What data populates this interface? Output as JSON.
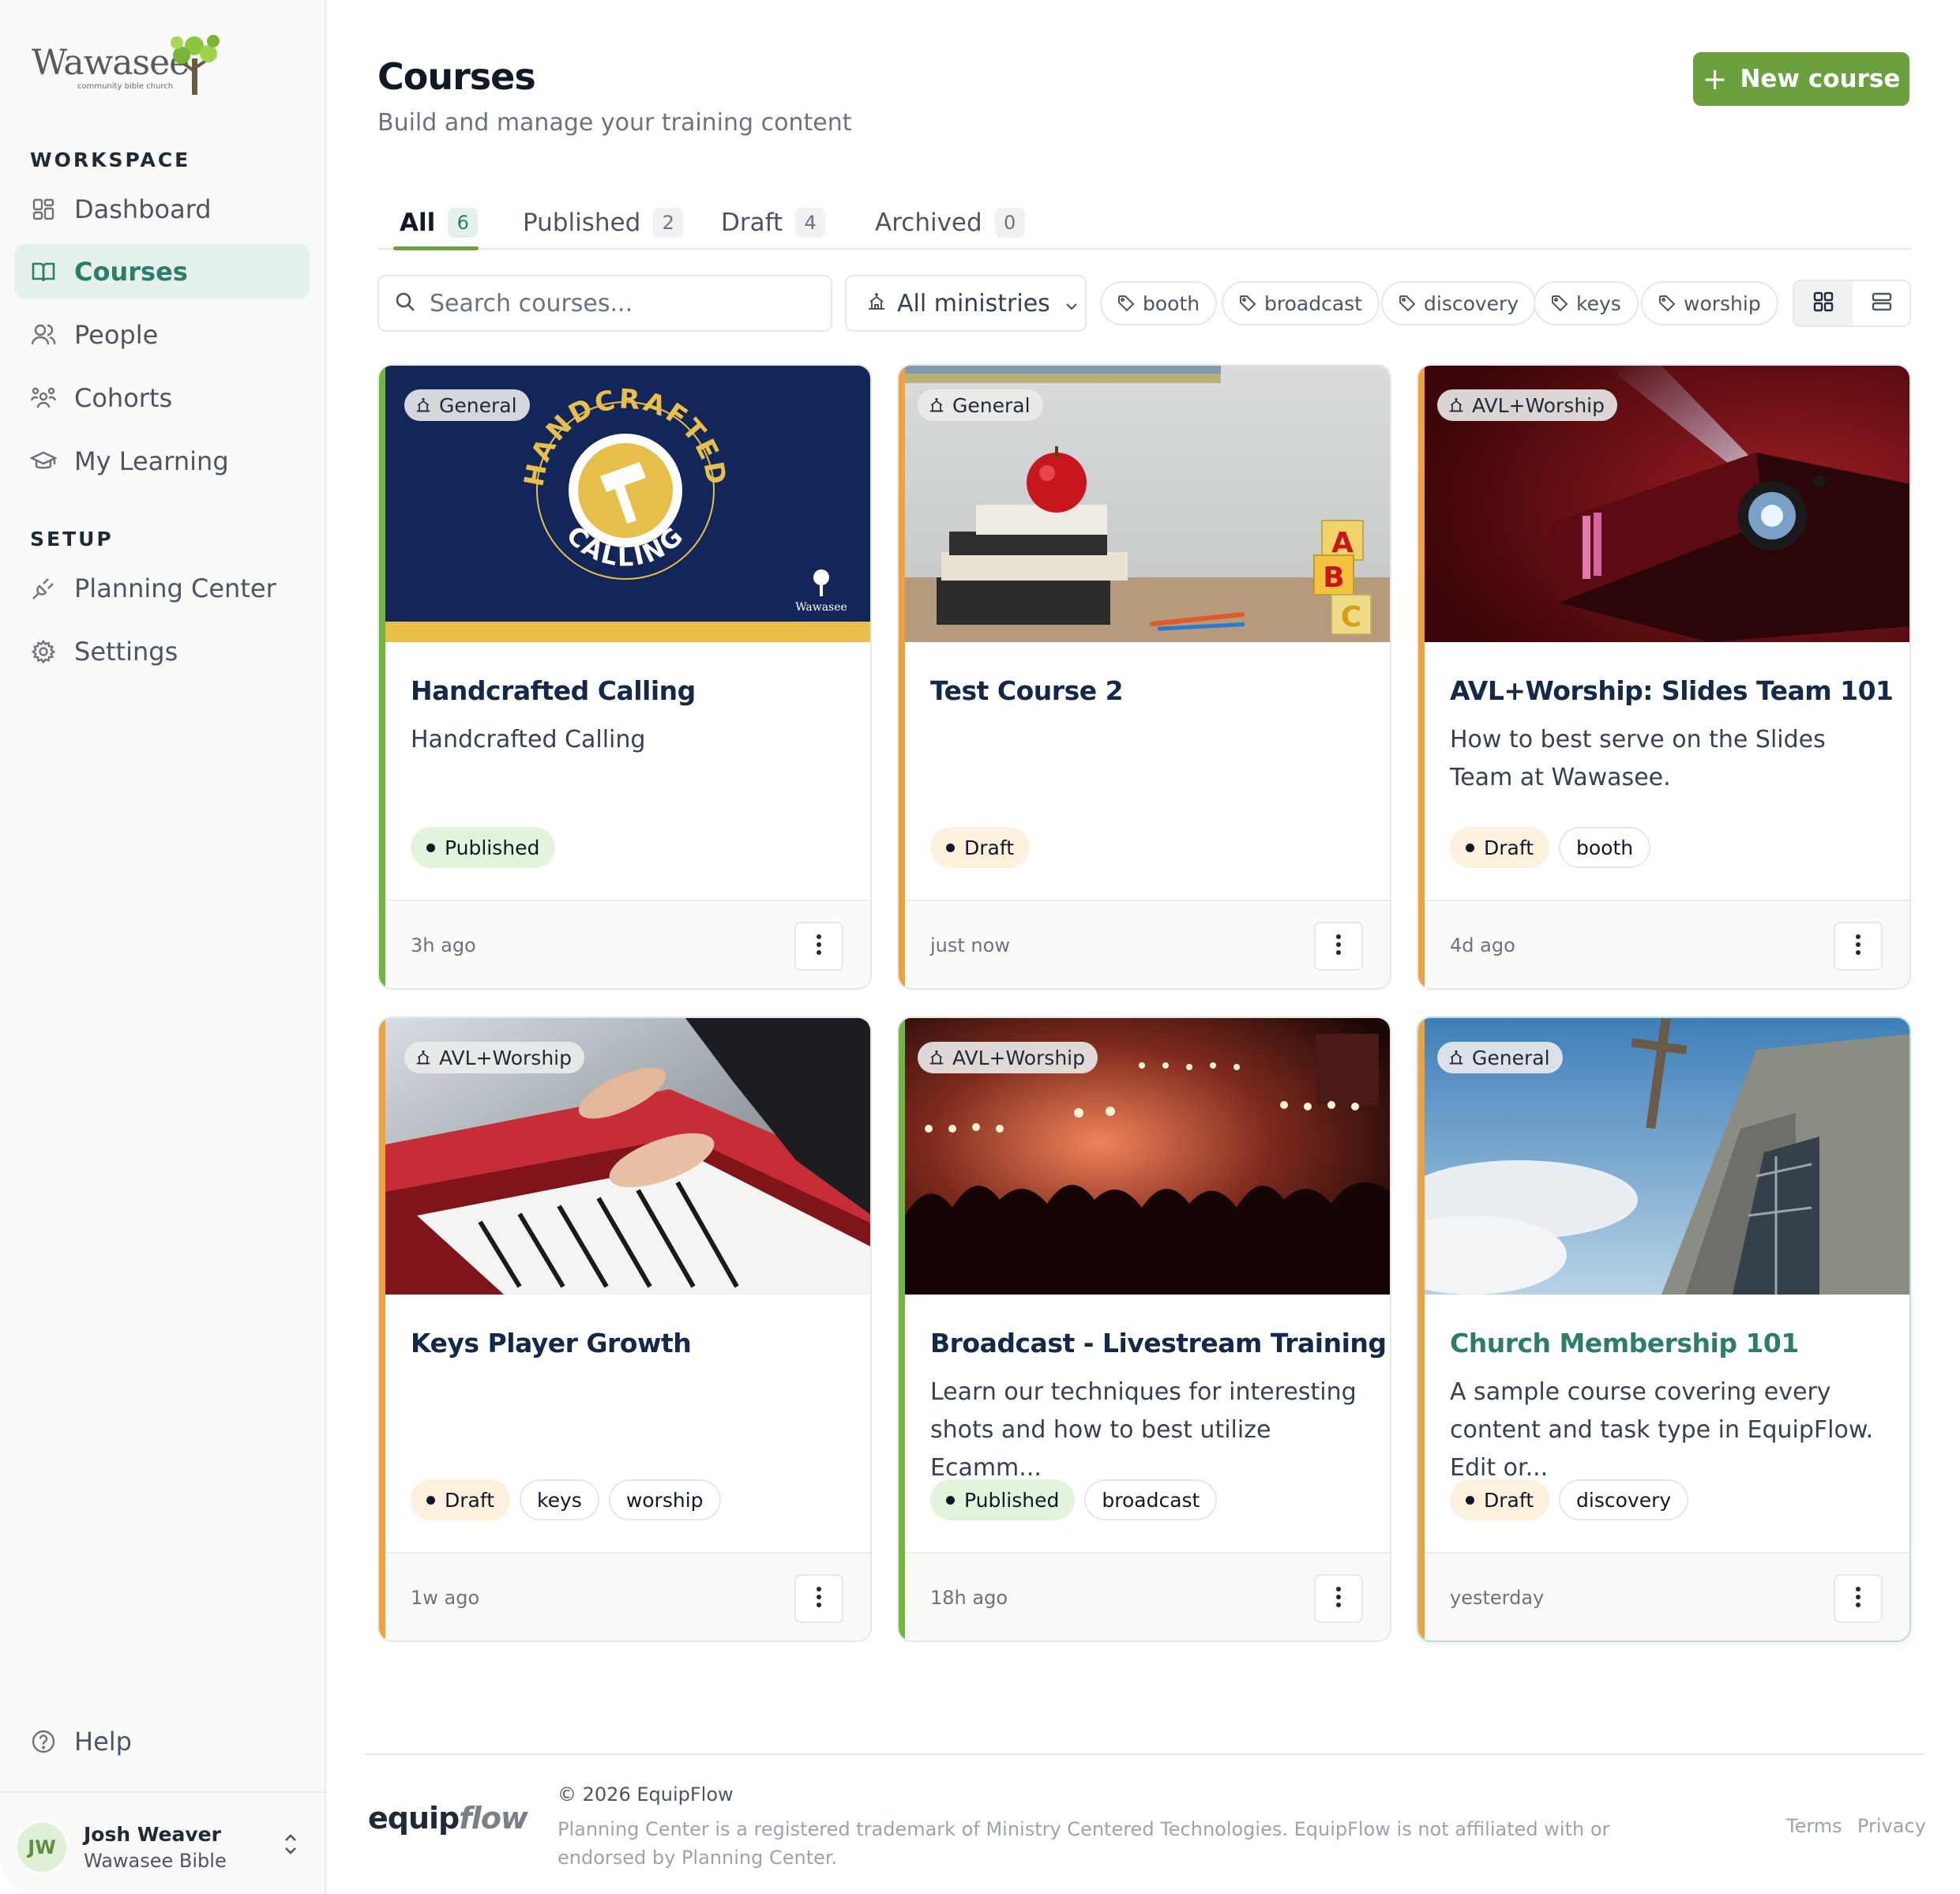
{
  "brand": {
    "logo_text": "Wawasee",
    "logo_subtext": "community bible church"
  },
  "sidebar": {
    "workspace_label": "WORKSPACE",
    "workspace_items": [
      {
        "label": "Dashboard",
        "icon": "dashboard-icon"
      },
      {
        "label": "Courses",
        "icon": "book-icon",
        "active": true
      },
      {
        "label": "People",
        "icon": "people-icon"
      },
      {
        "label": "Cohorts",
        "icon": "cohorts-icon"
      },
      {
        "label": "My Learning",
        "icon": "graduation-cap-icon"
      }
    ],
    "setup_label": "SETUP",
    "setup_items": [
      {
        "label": "Planning Center",
        "icon": "plug-icon"
      },
      {
        "label": "Settings",
        "icon": "gear-icon"
      }
    ],
    "help_label": "Help",
    "user": {
      "initials": "JW",
      "name": "Josh Weaver",
      "org": "Wawasee Bible"
    }
  },
  "header": {
    "title": "Courses",
    "subtitle": "Build and manage your training content",
    "new_button": "New course"
  },
  "tabs": [
    {
      "label": "All",
      "count": "6",
      "active": true
    },
    {
      "label": "Published",
      "count": "2"
    },
    {
      "label": "Draft",
      "count": "4"
    },
    {
      "label": "Archived",
      "count": "0"
    }
  ],
  "filters": {
    "search_placeholder": "Search courses...",
    "ministry_select": "All ministries",
    "tags": [
      "booth",
      "broadcast",
      "discovery",
      "keys",
      "worship"
    ]
  },
  "courses": [
    {
      "ministry": "General",
      "title": "Handcrafted Calling",
      "description": "Handcrafted Calling",
      "status": "Published",
      "tags": [],
      "updated": "3h ago",
      "thumb_text_top": "HANDCRAFTED",
      "thumb_text_bottom": "CALLING",
      "thumb_brand": "Wawasee"
    },
    {
      "ministry": "General",
      "title": "Test Course 2",
      "description": "",
      "status": "Draft",
      "tags": [],
      "updated": "just now",
      "blocks": [
        "A",
        "B",
        "C"
      ]
    },
    {
      "ministry": "AVL+Worship",
      "title": "AVL+Worship: Slides Team 101",
      "description": "How to best serve on the Slides Team at Wawasee.",
      "status": "Draft",
      "tags": [
        "booth"
      ],
      "updated": "4d ago"
    },
    {
      "ministry": "AVL+Worship",
      "title": "Keys Player Growth",
      "description": "",
      "status": "Draft",
      "tags": [
        "keys",
        "worship"
      ],
      "updated": "1w ago"
    },
    {
      "ministry": "AVL+Worship",
      "title": "Broadcast - Livestream Training",
      "description": "Learn our techniques for interesting shots and how to best utilize Ecamm...",
      "status": "Published",
      "tags": [
        "broadcast"
      ],
      "updated": "18h ago"
    },
    {
      "ministry": "General",
      "title": "Church Membership 101",
      "description": "A sample course covering every content and task type in EquipFlow. Edit or...",
      "status": "Draft",
      "tags": [
        "discovery"
      ],
      "updated": "yesterday"
    }
  ],
  "footer": {
    "logo_equip": "equip",
    "logo_flow": "flow",
    "copyright": "© 2026 EquipFlow",
    "legal": "Planning Center is a registered trademark of Ministry Centered Technologies. EquipFlow is not affiliated with or endorsed by Planning Center.",
    "terms": "Terms",
    "privacy": "Privacy"
  },
  "colors": {
    "accent_green": "#6aa03e",
    "teal": "#2e7d6b",
    "published_stripe": "#72b63f",
    "draft_stripe": "#eea23e"
  }
}
